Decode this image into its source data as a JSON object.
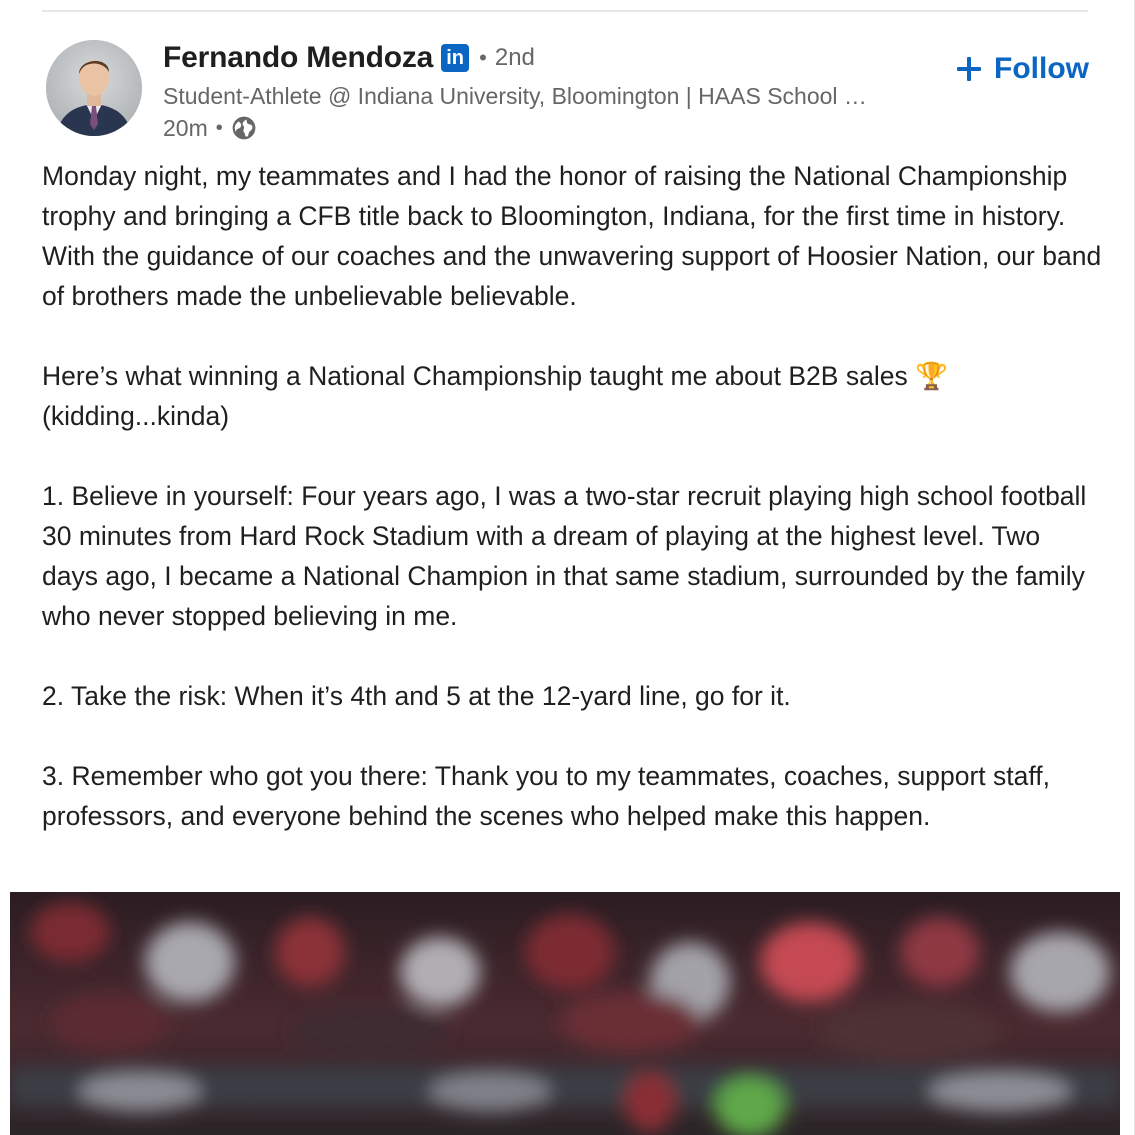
{
  "actor": {
    "name": "Fernando Mendoza",
    "badge": "in",
    "separator": "•",
    "degree": "2nd",
    "headline": "Student-Athlete @ Indiana University, Bloomington | HAAS School …",
    "time": "20m",
    "time_separator": "•",
    "visibility_icon": "globe-icon"
  },
  "follow": {
    "icon": "plus-icon",
    "label": "Follow"
  },
  "post": {
    "paragraphs": [
      "Monday night, my teammates and I had the honor of raising the National Championship trophy and bringing a CFB title back to Bloomington, Indiana, for the first time in history. With the guidance of our coaches and the unwavering support of Hoosier Nation, our band of brothers made the unbelievable believable.",
      "Here’s what winning a National Championship taught me about B2B sales 🏆 (kidding...kinda)",
      "1. Believe in yourself: Four years ago, I was a two-star recruit playing high school football 30 minutes from Hard Rock Stadium with a dream of playing at the highest level. Two days ago, I became a National Champion in that same stadium, surrounded by the family who never stopped believing in me.",
      "2. Take the risk: When it’s 4th and 5 at the 12-yard line, go for it.",
      "3. Remember who got you there: Thank you to my teammates, coaches, support staff, professors, and everyone behind the scenes who helped make this happen."
    ]
  },
  "colors": {
    "accent": "#0a66c2",
    "text": "#1f1f1f",
    "muted": "#666666"
  }
}
